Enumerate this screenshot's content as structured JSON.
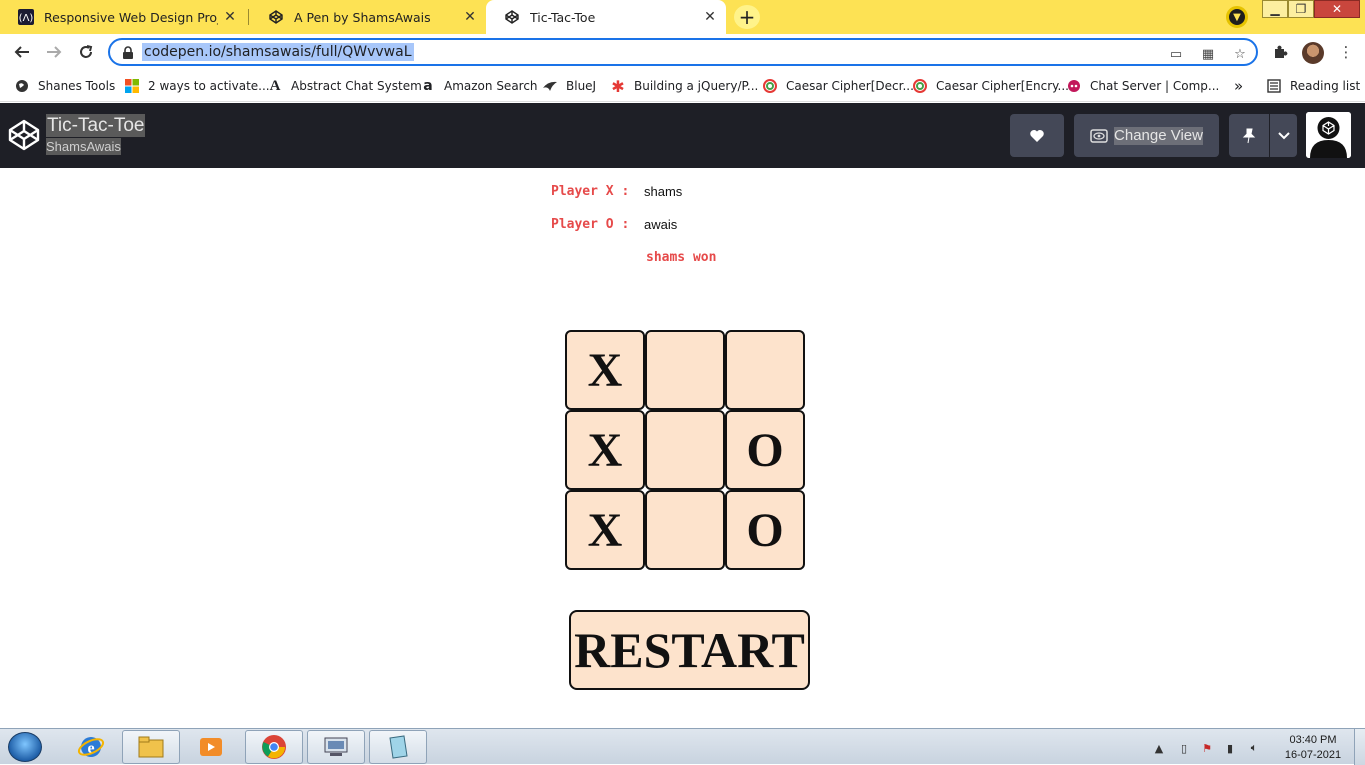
{
  "browser": {
    "tabs": [
      {
        "title": "Responsive Web Design Projects",
        "icon": "fcc-icon",
        "active": false
      },
      {
        "title": "A Pen by ShamsAwais",
        "icon": "codepen-icon",
        "active": false
      },
      {
        "title": "Tic-Tac-Toe",
        "icon": "codepen-icon",
        "active": true
      }
    ],
    "new_tab": "+",
    "url": "codepen.io/shamsawais/full/QWvvwaL",
    "bookmarks": [
      {
        "label": "Shanes Tools",
        "icon": "globe-icon"
      },
      {
        "label": "2 ways to activate...",
        "icon": "windows-icon"
      },
      {
        "label": "Abstract Chat System",
        "icon": "a-letter-icon"
      },
      {
        "label": "Amazon Search",
        "icon": "amazon-icon"
      },
      {
        "label": "BlueJ",
        "icon": "bird-icon"
      },
      {
        "label": "Building a jQuery/P...",
        "icon": "star-burst-icon"
      },
      {
        "label": "Caesar Cipher[Decr...",
        "icon": "swirl-icon"
      },
      {
        "label": "Caesar Cipher[Encry...",
        "icon": "swirl-icon"
      },
      {
        "label": "Chat Server | Comp...",
        "icon": "chat-icon"
      }
    ],
    "bookmarks_overflow": "»",
    "reading_list": "Reading list"
  },
  "codepen": {
    "pen_title": "Tic-Tac-Toe",
    "author": "ShamsAwais",
    "change_view_label": "Change View"
  },
  "game": {
    "player_x_label": "Player X :",
    "player_x_name": "shams",
    "player_o_label": "Player O :",
    "player_o_name": "awais",
    "status": "shams won",
    "board": [
      "X",
      "",
      "",
      "X",
      "",
      "O",
      "X",
      "",
      "O"
    ],
    "restart_label": "RESTART",
    "cell_color": "#fde3cc",
    "label_color": "#e64a4a"
  },
  "taskbar": {
    "time": "03:40 PM",
    "date": "16-07-2021"
  }
}
